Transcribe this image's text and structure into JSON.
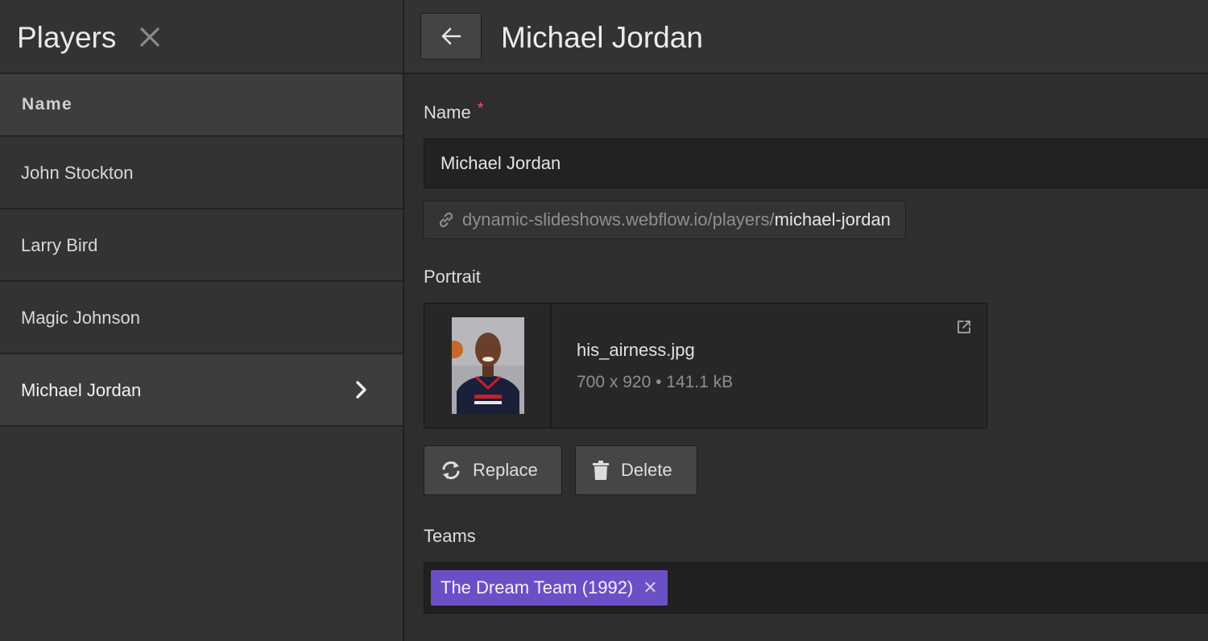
{
  "sidebar": {
    "title": "Players",
    "column_header": "Name",
    "items": [
      {
        "label": "John Stockton"
      },
      {
        "label": "Larry Bird"
      },
      {
        "label": "Magic Johnson"
      },
      {
        "label": "Michael Jordan",
        "active": true
      }
    ]
  },
  "detail": {
    "title": "Michael Jordan",
    "name_field": {
      "label": "Name",
      "required_mark": "*",
      "value": "Michael Jordan"
    },
    "url": {
      "base": "dynamic-slideshows.webflow.io/players/",
      "slug": "michael-jordan"
    },
    "portrait": {
      "label": "Portrait",
      "file_name": "his_airness.jpg",
      "file_meta": "700 x 920 • 141.1 kB",
      "replace_label": "Replace",
      "delete_label": "Delete"
    },
    "teams": {
      "label": "Teams",
      "tags": [
        {
          "label": "The Dream Team (1992)",
          "remove": "✕"
        }
      ]
    }
  },
  "colors": {
    "accent_tag": "#6b4fc4",
    "required": "#ff4d6a",
    "background": "#2e2e2e"
  },
  "icons": [
    "close-icon",
    "chevron-right-icon",
    "arrow-left-icon",
    "link-icon",
    "external-link-icon",
    "refresh-icon",
    "trash-icon"
  ]
}
